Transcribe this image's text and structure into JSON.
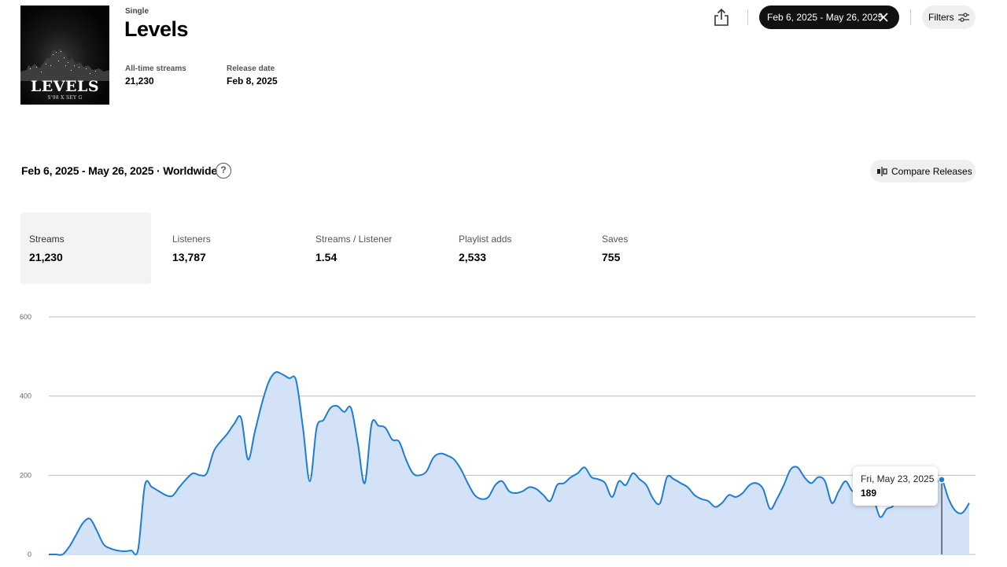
{
  "release": {
    "type_label": "Single",
    "title": "Levels",
    "cover": {
      "title": "LEVELS",
      "subtitle": "S'98 X SEY G"
    },
    "meta": [
      {
        "label": "All-time streams",
        "value": "21,230"
      },
      {
        "label": "Release date",
        "value": "Feb 8, 2025"
      }
    ]
  },
  "toolbar": {
    "share_icon": "share-icon",
    "date_range_label": "Feb 6, 2025 - May 26, 2025",
    "clear_icon": "close-icon",
    "filters_label": "Filters",
    "filters_icon": "sliders-icon"
  },
  "section": {
    "title": "Feb 6, 2025 - May 26, 2025 · Worldwide",
    "help_label": "?",
    "compare_label": "Compare Releases"
  },
  "metrics": [
    {
      "label": "Streams",
      "value": "21,230",
      "active": true
    },
    {
      "label": "Listeners",
      "value": "13,787",
      "active": false
    },
    {
      "label": "Streams / Listener",
      "value": "1.54",
      "active": false
    },
    {
      "label": "Playlist adds",
      "value": "2,533",
      "active": false
    },
    {
      "label": "Saves",
      "value": "755",
      "active": false
    }
  ],
  "colors": {
    "line": "#1e7dd2",
    "fill": "#d3e2f6",
    "active_tile": "#f3f3f3",
    "grid": "#bdbdbd"
  },
  "chart_data": {
    "type": "area",
    "ylim": [
      0,
      600
    ],
    "yticks": [
      "0",
      "200",
      "400",
      "600"
    ],
    "grid": true,
    "x_start": "Feb 6, 2025",
    "x_end": "May 26, 2025",
    "series": [
      {
        "values": [
          0,
          0,
          0,
          20,
          50,
          80,
          90,
          60,
          25,
          15,
          10,
          8,
          10,
          12,
          175,
          170,
          160,
          150,
          148,
          170,
          190,
          205,
          200,
          205,
          260,
          285,
          305,
          330,
          345,
          240,
          310,
          380,
          435,
          460,
          455,
          445,
          440,
          320,
          185,
          320,
          340,
          370,
          375,
          360,
          370,
          280,
          180,
          330,
          325,
          320,
          290,
          285,
          240,
          205,
          200,
          210,
          245,
          255,
          250,
          240,
          215,
          180,
          150,
          140,
          145,
          175,
          185,
          160,
          155,
          160,
          170,
          165,
          150,
          135,
          175,
          180,
          195,
          205,
          220,
          195,
          190,
          180,
          145,
          185,
          175,
          205,
          190,
          175,
          140,
          130,
          195,
          190,
          180,
          170,
          150,
          140,
          135,
          120,
          130,
          150,
          145,
          155,
          175,
          180,
          165,
          115,
          140,
          175,
          215,
          220,
          195,
          180,
          195,
          185,
          130,
          160,
          185,
          160,
          170,
          160,
          145,
          95,
          115,
          125,
          175,
          185,
          150,
          125,
          145,
          175,
          189,
          140,
          110,
          105,
          130
        ]
      }
    ],
    "tooltip": {
      "date": "Fri, May 23, 2025",
      "value": "189"
    }
  }
}
